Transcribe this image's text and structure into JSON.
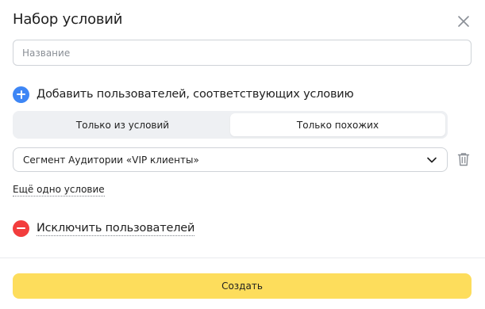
{
  "dialog": {
    "title": "Набор условий",
    "close_icon": "close-icon"
  },
  "name_field": {
    "value": "",
    "placeholder": "Название"
  },
  "include_section": {
    "icon": "plus-circle-icon",
    "label": "Добавить пользователей, соответствующих условию",
    "segments": [
      {
        "label": "Только из условий",
        "active": false
      },
      {
        "label": "Только похожих",
        "active": true
      }
    ],
    "condition": {
      "value": "Сегмент Аудитории «VIP клиенты»",
      "chevron_icon": "chevron-down-icon",
      "delete_icon": "trash-icon"
    },
    "add_condition_link": "Ещё одно условие"
  },
  "exclude_section": {
    "icon": "minus-circle-icon",
    "label": "Исключить пользователей"
  },
  "footer": {
    "create_label": "Создать"
  },
  "colors": {
    "accent_blue": "#3e86f5",
    "danger_red": "#f23d3d",
    "primary_yellow": "#fddd5c",
    "segment_bg": "#eef0f3"
  }
}
